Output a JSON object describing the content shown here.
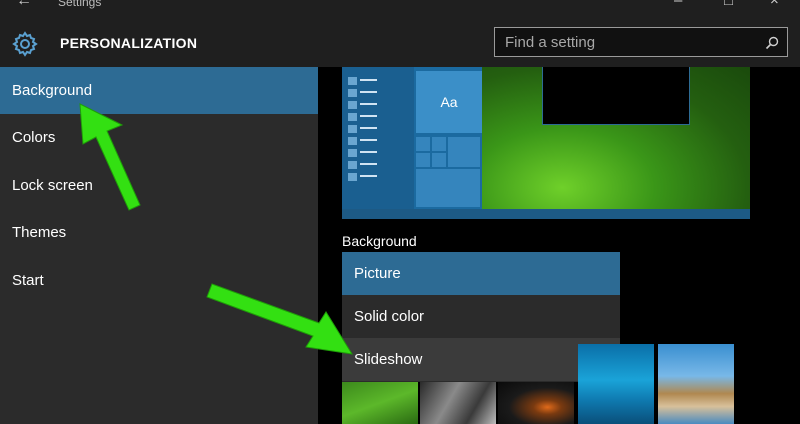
{
  "window": {
    "title": "Settings"
  },
  "header": {
    "title": "PERSONALIZATION",
    "search": {
      "placeholder": "Find a setting"
    }
  },
  "sidebar": {
    "items": [
      {
        "label": "Background",
        "active": true
      },
      {
        "label": "Colors"
      },
      {
        "label": "Lock screen"
      },
      {
        "label": "Themes"
      },
      {
        "label": "Start"
      }
    ]
  },
  "main": {
    "preview": {
      "tile_label": "Aa"
    },
    "background_label": "Background",
    "dropdown": {
      "options": [
        "Picture",
        "Solid color",
        "Slideshow"
      ],
      "selected": "Picture"
    }
  },
  "colors": {
    "accent": "#2d6b94",
    "sidebar_bg": "#2b2b2b",
    "header_bg": "#1f1f1f",
    "annotation_arrow": "#33e012"
  }
}
